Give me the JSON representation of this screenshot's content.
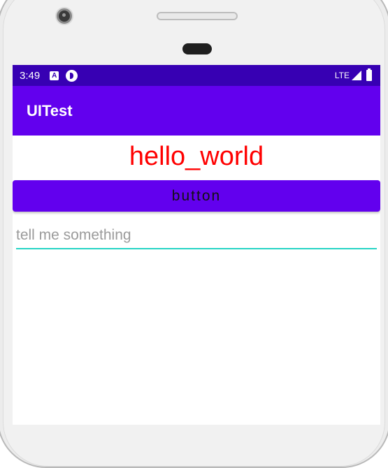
{
  "status_bar": {
    "time": "3:49",
    "notification_icon_a": "A",
    "network": "LTE"
  },
  "app_bar": {
    "title": "UITest"
  },
  "content": {
    "hello_text": "hello_world",
    "button_label": "button",
    "input": {
      "value": "",
      "placeholder": "tell me something"
    }
  },
  "colors": {
    "status_bar": "#3700b3",
    "app_bar": "#6200ee",
    "hello_text": "#ff0000",
    "button_bg": "#6200ee",
    "input_underline": "#26d4c5"
  },
  "icons": [
    "camera-icon",
    "speaker-icon",
    "sensor-icon",
    "notification-a-icon",
    "notification-circle-icon",
    "signal-icon",
    "battery-icon"
  ]
}
